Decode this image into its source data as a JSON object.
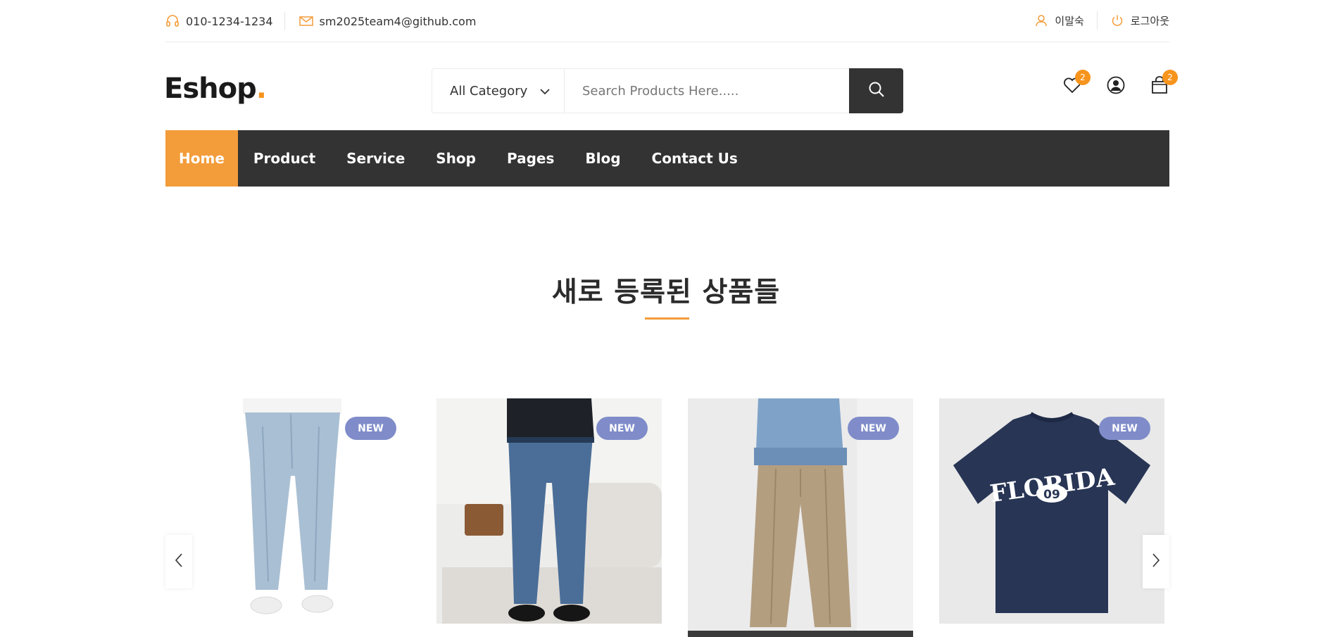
{
  "topbar": {
    "phone": "010-1234-1234",
    "email": "sm2025team4@github.com",
    "user_name": "이말숙",
    "logout_label": "로그아웃"
  },
  "header": {
    "logo_text": "Eshop",
    "logo_dot": ".",
    "category_label": "All Category",
    "search_placeholder": "Search Products Here.....",
    "wishlist_count": "2",
    "cart_count": "2"
  },
  "nav": {
    "items": [
      "Home",
      "Product",
      "Service",
      "Shop",
      "Pages",
      "Blog",
      "Contact Us"
    ],
    "active": "Home"
  },
  "section": {
    "title": "새로 등록된 상품들"
  },
  "products": [
    {
      "badge": "NEW",
      "image": "light-blue-jeans"
    },
    {
      "badge": "NEW",
      "image": "blue-straight-jeans"
    },
    {
      "badge": "NEW",
      "image": "beige-wide-trousers"
    },
    {
      "badge": "NEW",
      "image": "navy-florida-tshirt",
      "print_text": "FLORIDA",
      "print_number": "09"
    }
  ],
  "colors": {
    "accent": "#f39c3a",
    "dark": "#333333",
    "badge": "#7f8cc9"
  },
  "icons": [
    "headset-icon",
    "mail-icon",
    "user-icon",
    "power-icon",
    "chevron-down-icon",
    "search-icon",
    "heart-icon",
    "account-icon",
    "shopping-bag-icon",
    "chevron-left-icon",
    "chevron-right-icon"
  ]
}
